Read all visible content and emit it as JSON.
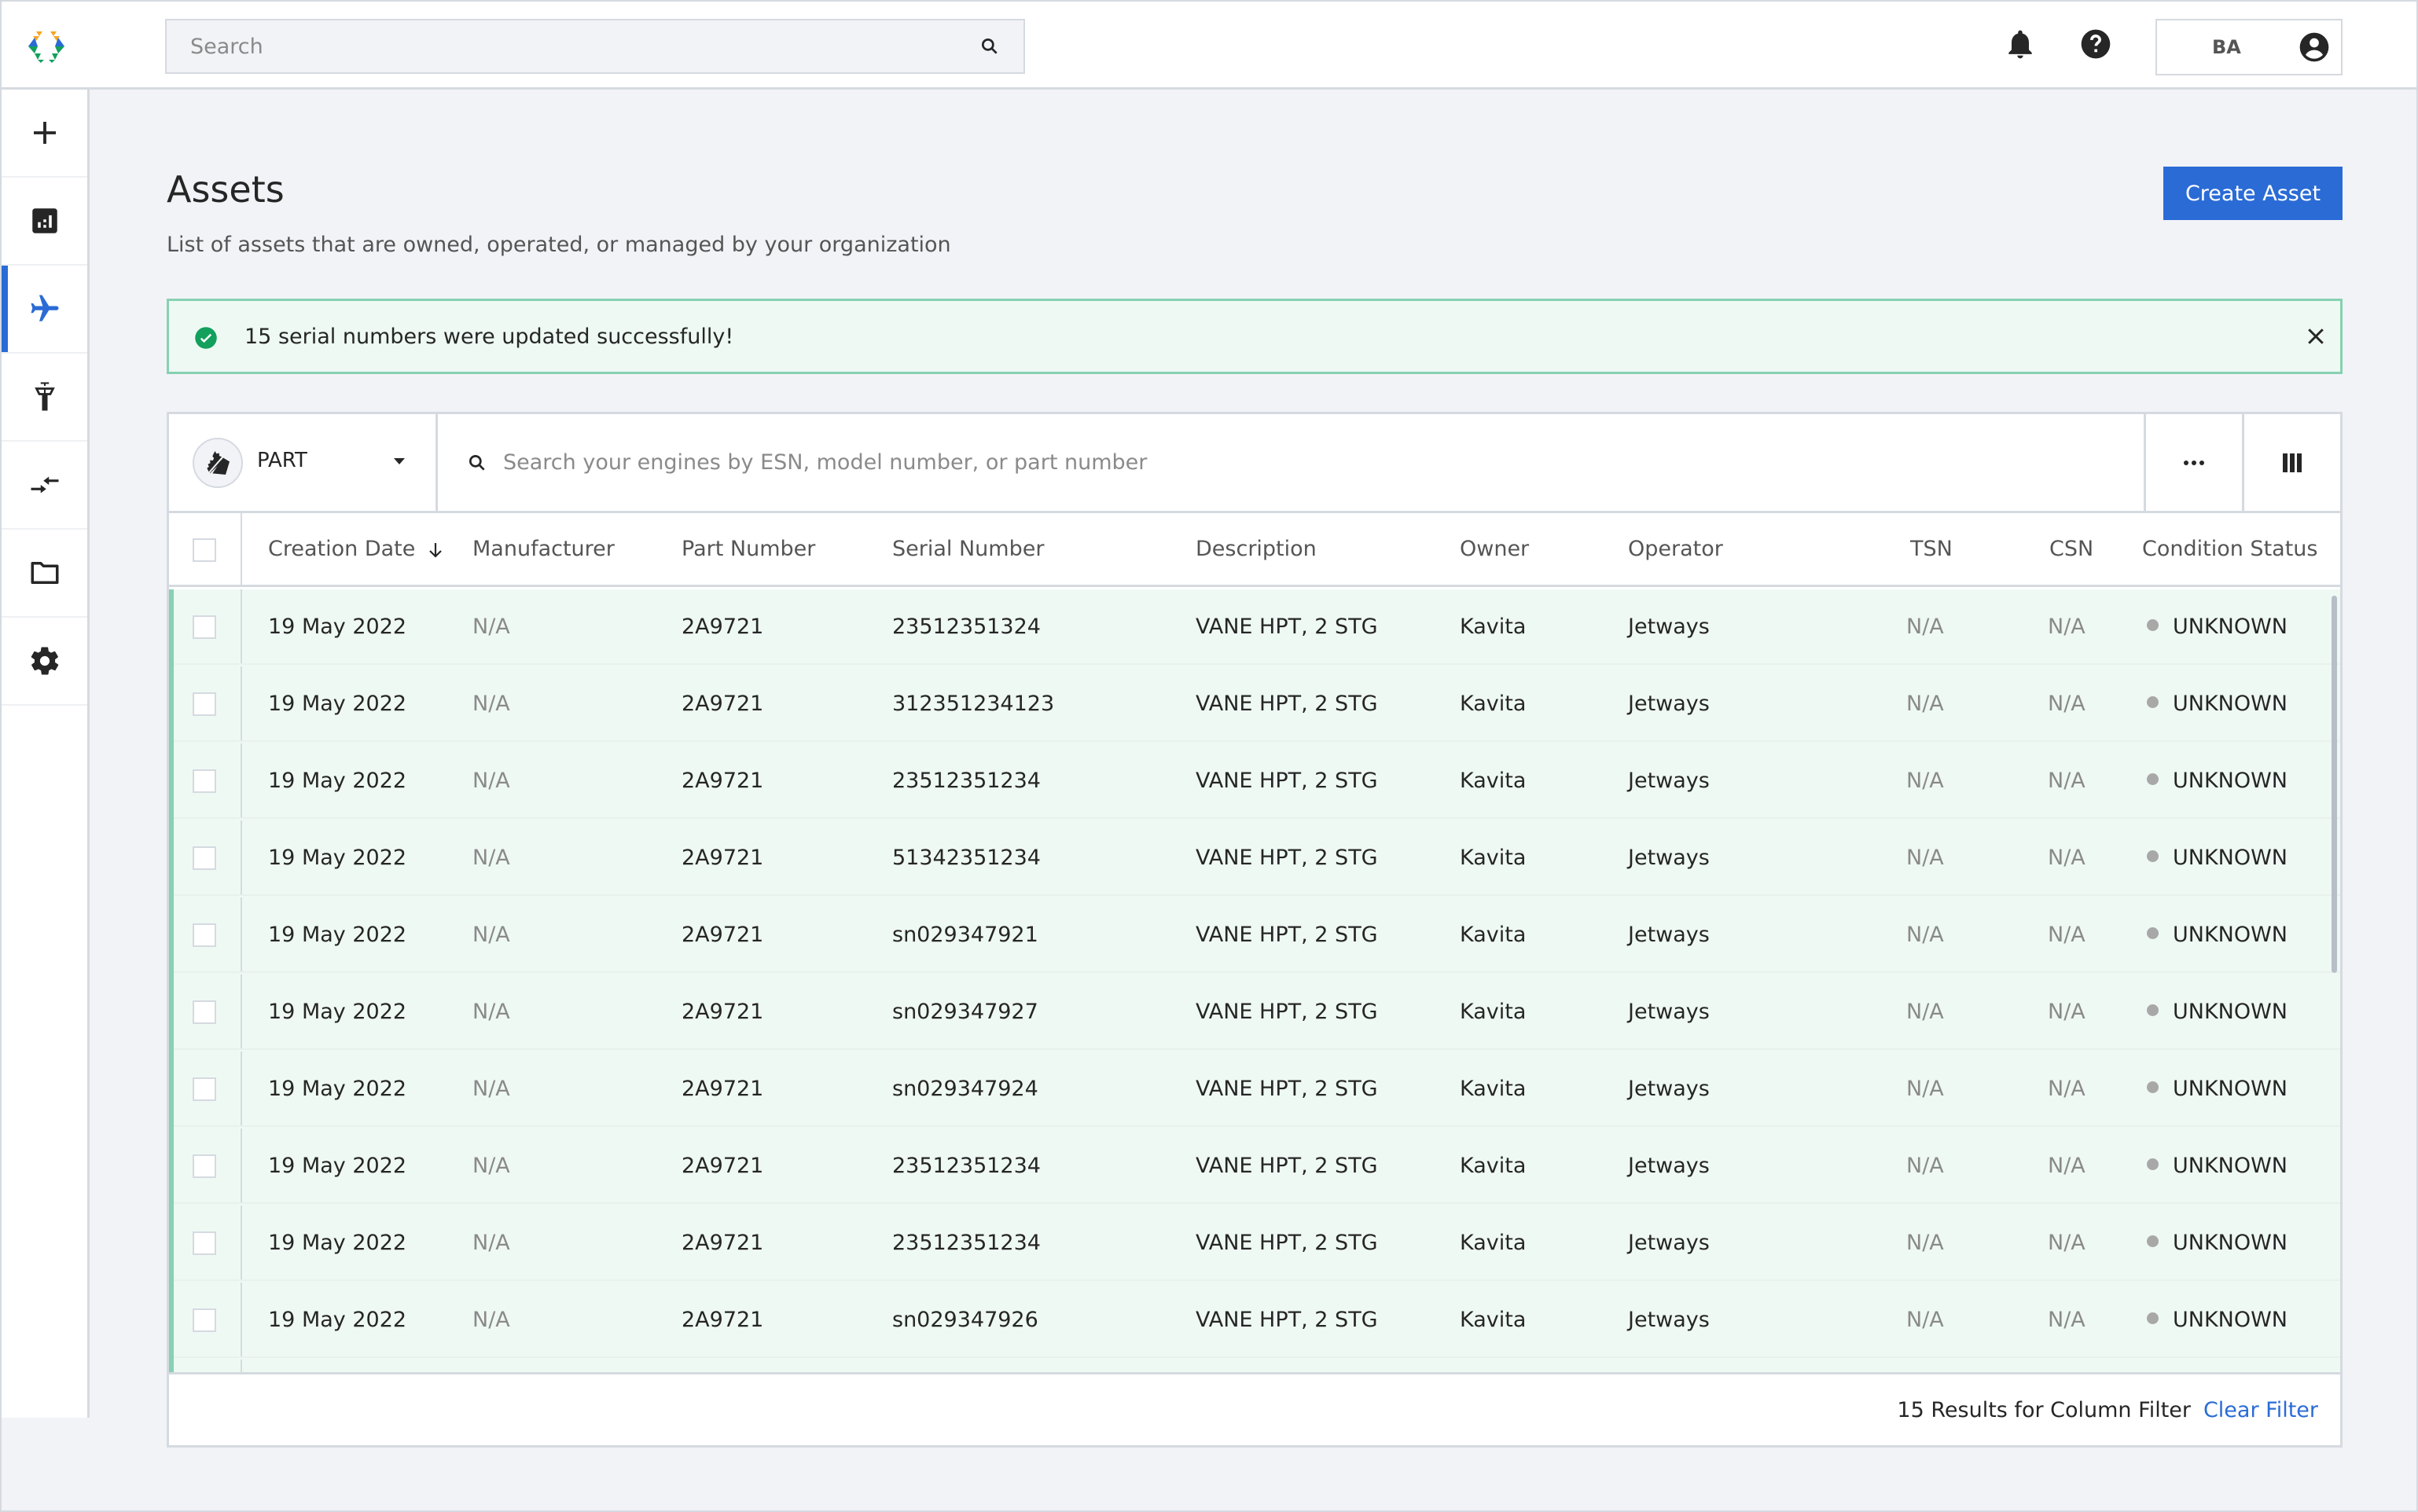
{
  "header": {
    "logo": "app-logo",
    "search_placeholder": "Search",
    "icons": [
      "bell-icon",
      "help-icon"
    ],
    "user_initials": "BA",
    "user_icon": "account-circle-icon"
  },
  "sidebar": {
    "items": [
      {
        "name": "create",
        "icon": "plus-icon",
        "active": false
      },
      {
        "name": "reports",
        "icon": "bar-chart-icon",
        "active": false
      },
      {
        "name": "assets",
        "icon": "airplane-icon",
        "active": true
      },
      {
        "name": "airports",
        "icon": "control-tower-icon",
        "active": false
      },
      {
        "name": "transfers",
        "icon": "swap-arrows-icon",
        "active": false
      },
      {
        "name": "documents",
        "icon": "folder-icon",
        "active": false
      },
      {
        "name": "settings",
        "icon": "gear-icon",
        "active": false
      }
    ]
  },
  "page": {
    "title": "Assets",
    "subtitle": "List of assets that are owned, operated, or managed by your organization",
    "create_button": "Create Asset"
  },
  "alert": {
    "message": "15 serial numbers were updated successfully!",
    "color": "#86d1b2"
  },
  "toolbar": {
    "asset_type": "PART",
    "search_placeholder": "Search your engines by ESN, model number, or part number"
  },
  "table": {
    "columns": [
      {
        "key": "date",
        "label": "Creation Date",
        "sort": "desc"
      },
      {
        "key": "manufacturer",
        "label": "Manufacturer"
      },
      {
        "key": "part",
        "label": "Part Number"
      },
      {
        "key": "serial",
        "label": "Serial Number"
      },
      {
        "key": "description",
        "label": "Description"
      },
      {
        "key": "owner",
        "label": "Owner"
      },
      {
        "key": "operator",
        "label": "Operator"
      },
      {
        "key": "tsn",
        "label": "TSN"
      },
      {
        "key": "csn",
        "label": "CSN"
      },
      {
        "key": "status",
        "label": "Condition Status"
      }
    ],
    "rows": [
      {
        "date": "19 May 2022",
        "manufacturer": "N/A",
        "part": "2A9721",
        "serial": "23512351324",
        "description": "VANE HPT, 2 STG",
        "owner": "Kavita",
        "operator": "Jetways",
        "tsn": "N/A",
        "csn": "N/A",
        "status": "UNKNOWN"
      },
      {
        "date": "19 May 2022",
        "manufacturer": "N/A",
        "part": "2A9721",
        "serial": "312351234123",
        "description": "VANE HPT, 2 STG",
        "owner": "Kavita",
        "operator": "Jetways",
        "tsn": "N/A",
        "csn": "N/A",
        "status": "UNKNOWN"
      },
      {
        "date": "19 May 2022",
        "manufacturer": "N/A",
        "part": "2A9721",
        "serial": "23512351234",
        "description": "VANE HPT, 2 STG",
        "owner": "Kavita",
        "operator": "Jetways",
        "tsn": "N/A",
        "csn": "N/A",
        "status": "UNKNOWN"
      },
      {
        "date": "19 May 2022",
        "manufacturer": "N/A",
        "part": "2A9721",
        "serial": "51342351234",
        "description": "VANE HPT, 2 STG",
        "owner": "Kavita",
        "operator": "Jetways",
        "tsn": "N/A",
        "csn": "N/A",
        "status": "UNKNOWN"
      },
      {
        "date": "19 May 2022",
        "manufacturer": "N/A",
        "part": "2A9721",
        "serial": "sn029347921",
        "description": "VANE HPT, 2 STG",
        "owner": "Kavita",
        "operator": "Jetways",
        "tsn": "N/A",
        "csn": "N/A",
        "status": "UNKNOWN"
      },
      {
        "date": "19 May 2022",
        "manufacturer": "N/A",
        "part": "2A9721",
        "serial": "sn029347927",
        "description": "VANE HPT, 2 STG",
        "owner": "Kavita",
        "operator": "Jetways",
        "tsn": "N/A",
        "csn": "N/A",
        "status": "UNKNOWN"
      },
      {
        "date": "19 May 2022",
        "manufacturer": "N/A",
        "part": "2A9721",
        "serial": "sn029347924",
        "description": "VANE HPT, 2 STG",
        "owner": "Kavita",
        "operator": "Jetways",
        "tsn": "N/A",
        "csn": "N/A",
        "status": "UNKNOWN"
      },
      {
        "date": "19 May 2022",
        "manufacturer": "N/A",
        "part": "2A9721",
        "serial": "23512351234",
        "description": "VANE HPT, 2 STG",
        "owner": "Kavita",
        "operator": "Jetways",
        "tsn": "N/A",
        "csn": "N/A",
        "status": "UNKNOWN"
      },
      {
        "date": "19 May 2022",
        "manufacturer": "N/A",
        "part": "2A9721",
        "serial": "23512351234",
        "description": "VANE HPT, 2 STG",
        "owner": "Kavita",
        "operator": "Jetways",
        "tsn": "N/A",
        "csn": "N/A",
        "status": "UNKNOWN"
      },
      {
        "date": "19 May 2022",
        "manufacturer": "N/A",
        "part": "2A9721",
        "serial": "sn029347926",
        "description": "VANE HPT, 2 STG",
        "owner": "Kavita",
        "operator": "Jetways",
        "tsn": "N/A",
        "csn": "N/A",
        "status": "UNKNOWN"
      }
    ],
    "status_color": "#a8a8a8",
    "row_highlight_color": "#eff9f4"
  },
  "footer": {
    "results_text": "15 Results for Column Filter",
    "clear_filter": "Clear Filter"
  },
  "colors": {
    "accent": "#2a6bd6",
    "success": "#12a05c",
    "background": "#f2f3f7",
    "border": "#d5dae0"
  }
}
